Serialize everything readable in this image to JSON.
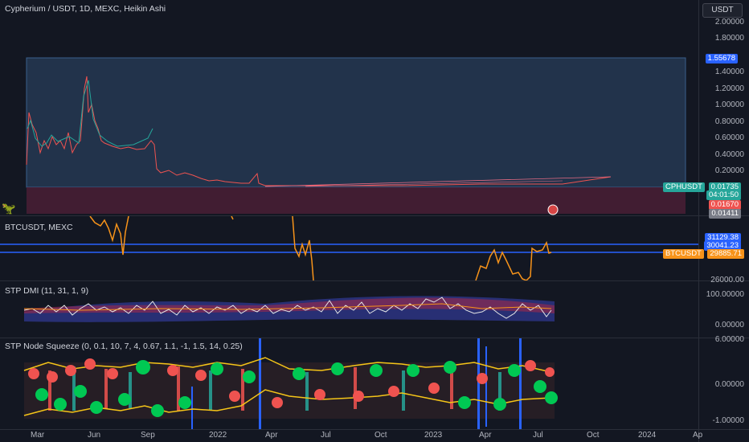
{
  "header": {
    "title": "Cypherium / USDT, 1D, MEXC, Heikin Ashi",
    "currency": "USDT"
  },
  "main_axis": {
    "ticks": [
      "2.00000",
      "1.80000",
      "1.40000",
      "1.20000",
      "1.00000",
      "0.80000",
      "0.60000",
      "0.40000",
      "0.20000"
    ],
    "high_tag": "1.55678",
    "symbol_tag": "CPHUSDT",
    "price_tag": "0.01735",
    "countdown": "04:01:50",
    "tag_red": "0.01670",
    "tag_gray": "0.01411"
  },
  "compare_pane": {
    "label": "BTCUSDT, MEXC",
    "tag_top_partial": "31129.38",
    "tag_upper": "30041.23",
    "symbol_tag": "BTCUSDT",
    "price_tag": "29885.71",
    "tick_bottom": "26000.00"
  },
  "dmi_pane": {
    "label": "STP DMI (11, 31, 1, 9)",
    "ticks": [
      "100.00000",
      "0.00000"
    ]
  },
  "squeeze_pane": {
    "label": "STP Node Squeeze (0, 0.1, 10, 7, 4, 0.67, 1.1, -1, 1.5, 14, 0.25)",
    "ticks": [
      "6.00000",
      "0.00000",
      "-1.00000"
    ]
  },
  "time_axis": {
    "labels": [
      "Mar",
      "Jun",
      "Sep",
      "2022",
      "Apr",
      "Jul",
      "Oct",
      "2023",
      "Apr",
      "Jul",
      "Oct",
      "2024",
      "Ap"
    ]
  },
  "colors": {
    "background": "#131722",
    "up": "#26a69a",
    "down": "#ef5350",
    "btc_line": "#f7931a",
    "blue_line": "#2962ff",
    "yellow": "#f5c518"
  }
}
